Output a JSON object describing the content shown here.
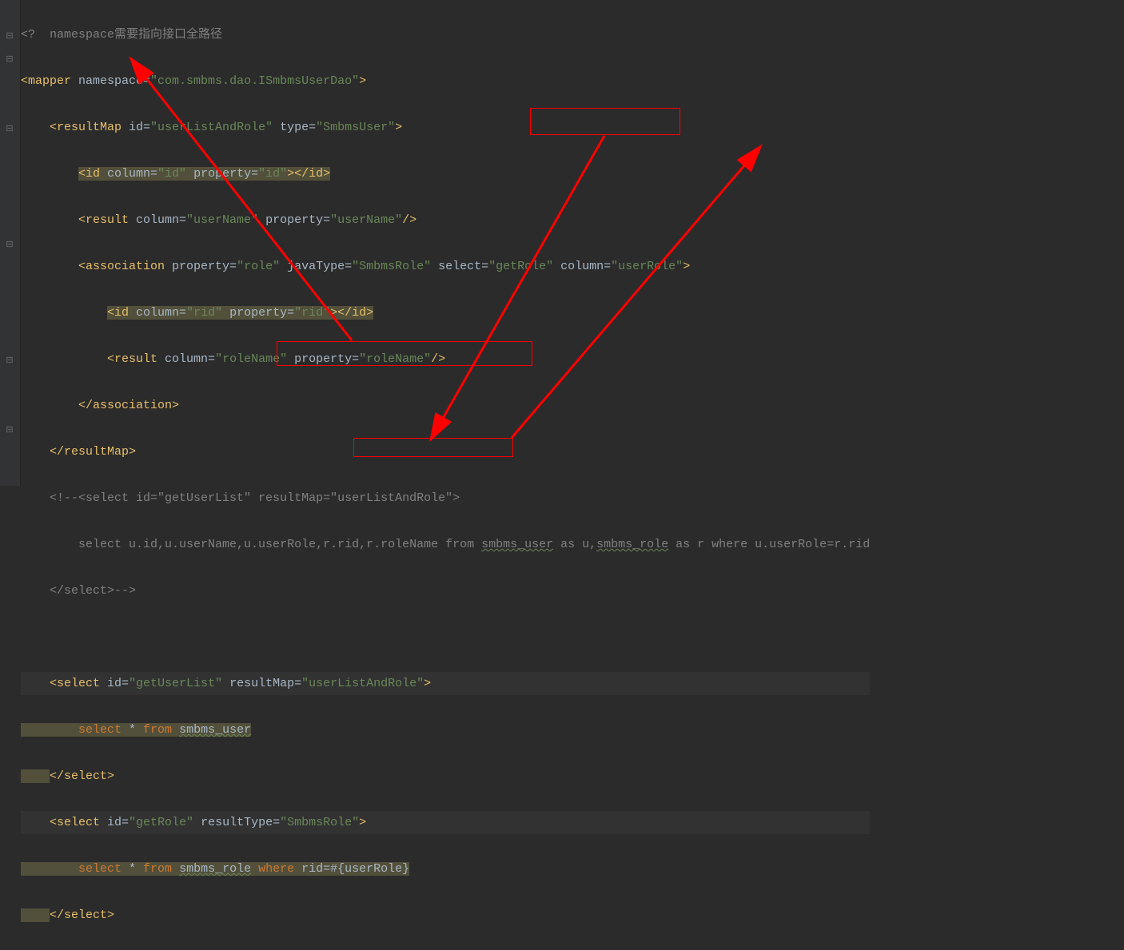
{
  "domain": "Computer-Use",
  "lines": {
    "l0": "<?  namespace需要指向接口全路径",
    "l1_open": "<mapper",
    "l1_ns": " namespace=",
    "l1_nsv": "\"com.smbms.dao.ISmbmsUserDao\"",
    "l1_close": ">",
    "l2_open": "<resultMap",
    "l2_id": " id=",
    "l2_idv": "\"userListAndRole\"",
    "l2_ty": " type=",
    "l2_tyv": "\"SmbmsUser\"",
    "l2_close": ">",
    "l3_open": "<id",
    "l3_col": " column=",
    "l3_colv": "\"id\"",
    "l3_prop": " property=",
    "l3_propv": "\"id\"",
    "l3_close": "></id>",
    "l4_open": "<result",
    "l4_col": " column=",
    "l4_colv": "\"userName\"",
    "l4_prop": " property=",
    "l4_propv": "\"userName\"",
    "l4_close": "/>",
    "l5_open": "<association",
    "l5_prop": " property=",
    "l5_propv": "\"role\"",
    "l5_jt": " javaType=",
    "l5_jtv": "\"SmbmsRole\"",
    "l5_sel": " select=",
    "l5_selv": "\"getRole\"",
    "l5_col": " column=",
    "l5_colv": "\"userRole\"",
    "l5_close": ">",
    "l6_open": "<id",
    "l6_col": " column=",
    "l6_colv": "\"rid\"",
    "l6_prop": " property=",
    "l6_propv": "\"rid\"",
    "l6_close": "></id>",
    "l7_open": "<result",
    "l7_col": " column=",
    "l7_colv": "\"roleName\"",
    "l7_prop": " property=",
    "l7_propv": "\"roleName\"",
    "l7_close": "/>",
    "l8": "</association>",
    "l9": "</resultMap>",
    "l10": "<!--<select id=\"getUserList\" resultMap=\"userListAndRole\">",
    "l11a": "    select u.id,u.userName,u.userRole,r.rid,r.roleName from ",
    "l11b": "smbms_user",
    "l11c": " as u,",
    "l11d": "smbms_role",
    "l11e": " as r where u.userRole=r.rid",
    "l12": "</select>-->",
    "l13": "",
    "l14": "",
    "l15_open": "<select",
    "l15_id": " id=",
    "l15_idv": "\"getUserList\"",
    "l15_rm": " resultMap=",
    "l15_rmv": "\"userListAndRole\"",
    "l15_close": ">",
    "l16_kw": "select",
    "l16_b": " * ",
    "l16_from": "from",
    "l16_c": " ",
    "l16_tbl": "smbms_user",
    "l17": "</select>",
    "l18_open": "<select",
    "l18_id": " id=",
    "l18_idv": "\"getRole\"",
    "l18_rt": " resultType=",
    "l18_rtv": "\"SmbmsRole\"",
    "l18_close": ">",
    "l19_kw": "select",
    "l19_b": " * ",
    "l19_from": "from",
    "l19_c": " ",
    "l19_tbl": "smbms_role",
    "l19_d": " ",
    "l19_where": "where",
    "l19_e": " rid=#{userRole}",
    "l20": "</select>"
  },
  "indent": {
    "i0": "",
    "i1": "    ",
    "i2": "        ",
    "i3": "            ",
    "i4": "                "
  }
}
